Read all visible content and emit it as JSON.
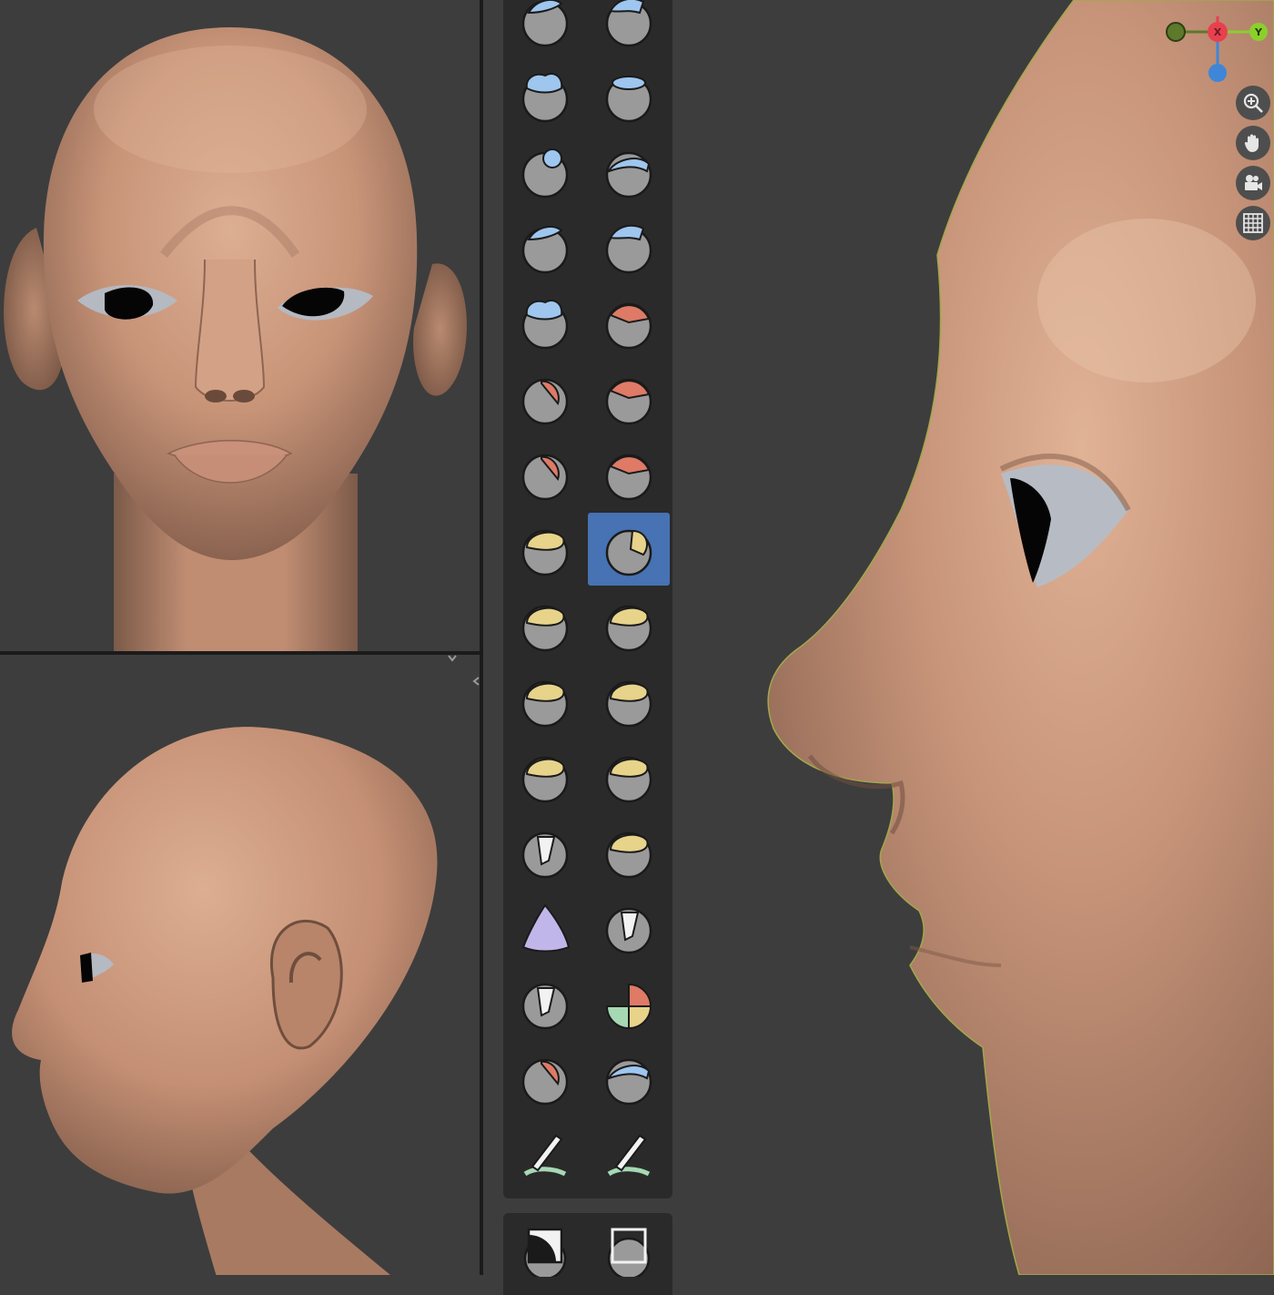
{
  "skin": {
    "base": "#c7957a",
    "light": "#e3b89c",
    "dark": "#7d5a48",
    "shadow": "#5b4336"
  },
  "colors": {
    "viewport_bg": "#3d3d3d",
    "toolbar_bg": "#2a2a2a",
    "active": "#4772b3",
    "tool_sphere": "#9a9a9a",
    "blue": "#9ec6ee",
    "red": "#de7a66",
    "yellow": "#e7d38a",
    "purple": "#c1b6e9",
    "green": "#a6d8b4"
  },
  "gizmo": {
    "x_label": "X",
    "y_label": "Y",
    "x_color": "#e8404e",
    "y_color": "#8bcf2c",
    "z_color": "#3f86d8",
    "neg_y_color": "#5c7a2a"
  },
  "nav_buttons": [
    {
      "name": "zoom-button",
      "icon": "zoom-icon"
    },
    {
      "name": "pan-button",
      "icon": "hand-icon"
    },
    {
      "name": "camera-button",
      "icon": "camera-icon"
    },
    {
      "name": "ortho-grid-button",
      "icon": "grid-icon"
    }
  ],
  "tools": [
    {
      "name": "tool-draw",
      "icon": "draw-brush-icon",
      "accent": "blue"
    },
    {
      "name": "tool-draw-sharp",
      "icon": "draw-sharp-brush-icon",
      "accent": "blue"
    },
    {
      "name": "tool-clay",
      "icon": "clay-brush-icon",
      "accent": "blue"
    },
    {
      "name": "tool-clay-strips",
      "icon": "clay-strips-brush-icon",
      "accent": "blue"
    },
    {
      "name": "tool-clay-thumb",
      "icon": "clay-thumb-brush-icon",
      "accent": "blue"
    },
    {
      "name": "tool-layer",
      "icon": "layer-brush-icon",
      "accent": "blue"
    },
    {
      "name": "tool-inflate",
      "icon": "inflate-brush-icon",
      "accent": "blue"
    },
    {
      "name": "tool-blob",
      "icon": "blob-brush-icon",
      "accent": "blue"
    },
    {
      "name": "tool-crease",
      "icon": "crease-brush-icon",
      "accent": "blue"
    },
    {
      "name": "tool-smooth",
      "icon": "smooth-brush-icon",
      "accent": "red"
    },
    {
      "name": "tool-flatten",
      "icon": "flatten-brush-icon",
      "accent": "red"
    },
    {
      "name": "tool-fill",
      "icon": "fill-brush-icon",
      "accent": "red"
    },
    {
      "name": "tool-scrape",
      "icon": "scrape-brush-icon",
      "accent": "red"
    },
    {
      "name": "tool-multiplane-scrape",
      "icon": "multiplane-scrape-brush-icon",
      "accent": "red"
    },
    {
      "name": "tool-pinch",
      "icon": "pinch-brush-icon",
      "accent": "yellow"
    },
    {
      "name": "tool-grab",
      "icon": "grab-brush-icon",
      "accent": "yellow",
      "active": true
    },
    {
      "name": "tool-elastic-deform",
      "icon": "elastic-deform-brush-icon",
      "accent": "yellow"
    },
    {
      "name": "tool-snake-hook",
      "icon": "snake-hook-brush-icon",
      "accent": "yellow"
    },
    {
      "name": "tool-thumb",
      "icon": "thumb-brush-icon",
      "accent": "yellow"
    },
    {
      "name": "tool-pose",
      "icon": "pose-brush-icon",
      "accent": "yellow"
    },
    {
      "name": "tool-nudge",
      "icon": "nudge-brush-icon",
      "accent": "yellow"
    },
    {
      "name": "tool-rotate",
      "icon": "rotate-brush-icon",
      "accent": "yellow"
    },
    {
      "name": "tool-slide-relax",
      "icon": "slide-relax-brush-icon",
      "accent": "white"
    },
    {
      "name": "tool-boundary",
      "icon": "boundary-brush-icon",
      "accent": "yellow"
    },
    {
      "name": "tool-cloth",
      "icon": "cloth-brush-icon",
      "accent": "purple"
    },
    {
      "name": "tool-simplify",
      "icon": "simplify-brush-icon",
      "accent": "white"
    },
    {
      "name": "tool-mask",
      "icon": "mask-brush-icon",
      "accent": "white"
    },
    {
      "name": "tool-draw-face-sets",
      "icon": "face-sets-brush-icon",
      "accent": "multi"
    },
    {
      "name": "tool-multires-eraser",
      "icon": "multires-eraser-brush-icon",
      "accent": "red"
    },
    {
      "name": "tool-multires-smear",
      "icon": "multires-smear-brush-icon",
      "accent": "blue"
    },
    {
      "name": "tool-paint",
      "icon": "paint-brush-icon",
      "accent": "green"
    },
    {
      "name": "tool-smear",
      "icon": "smear-brush-icon",
      "accent": "green"
    }
  ],
  "mask_tools": [
    {
      "name": "tool-box-mask",
      "icon": "box-mask-icon"
    },
    {
      "name": "tool-box-hide",
      "icon": "box-hide-icon"
    }
  ]
}
